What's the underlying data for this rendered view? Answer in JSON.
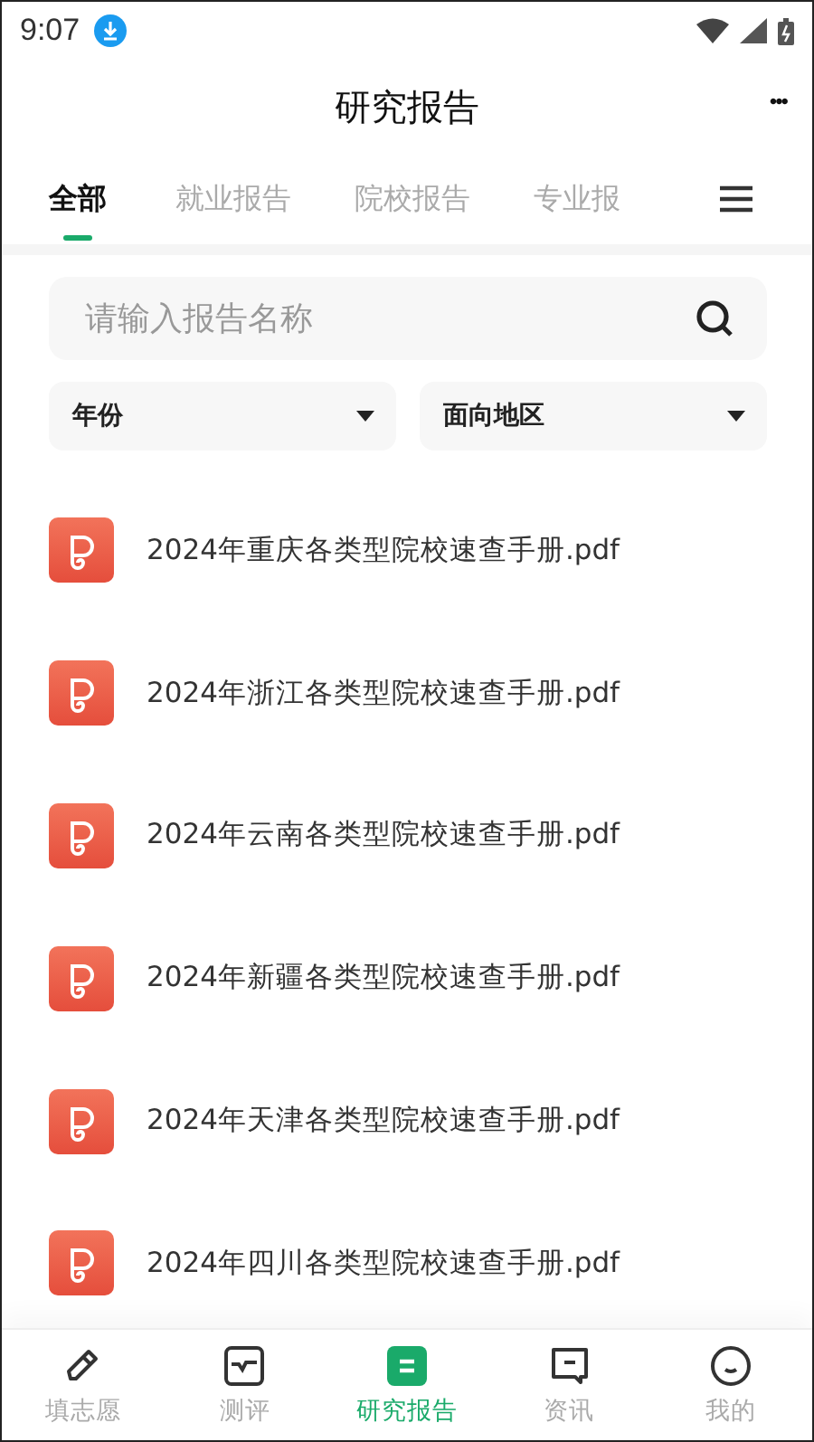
{
  "status_bar": {
    "time": "9:07"
  },
  "header": {
    "title": "研究报告",
    "more": "•••"
  },
  "tabs": [
    {
      "label": "全部",
      "selected": true
    },
    {
      "label": "就业报告",
      "selected": false
    },
    {
      "label": "院校报告",
      "selected": false
    },
    {
      "label": "专业报",
      "selected": false
    }
  ],
  "search": {
    "placeholder": "请输入报告名称"
  },
  "filters": [
    {
      "label": "年份"
    },
    {
      "label": "面向地区"
    }
  ],
  "files": [
    {
      "name": "2024年重庆各类型院校速查手册.pdf"
    },
    {
      "name": "2024年浙江各类型院校速查手册.pdf"
    },
    {
      "name": "2024年云南各类型院校速查手册.pdf"
    },
    {
      "name": "2024年新疆各类型院校速查手册.pdf"
    },
    {
      "name": "2024年天津各类型院校速查手册.pdf"
    },
    {
      "name": "2024年四川各类型院校速查手册.pdf"
    }
  ],
  "bottom_nav": [
    {
      "kind": "pencil",
      "label": "填志愿",
      "selected": false
    },
    {
      "kind": "chart",
      "label": "测评",
      "selected": false
    },
    {
      "kind": "report",
      "label": "研究报告",
      "selected": true
    },
    {
      "kind": "chat",
      "label": "资讯",
      "selected": false
    },
    {
      "kind": "smile",
      "label": "我的",
      "selected": false
    }
  ]
}
